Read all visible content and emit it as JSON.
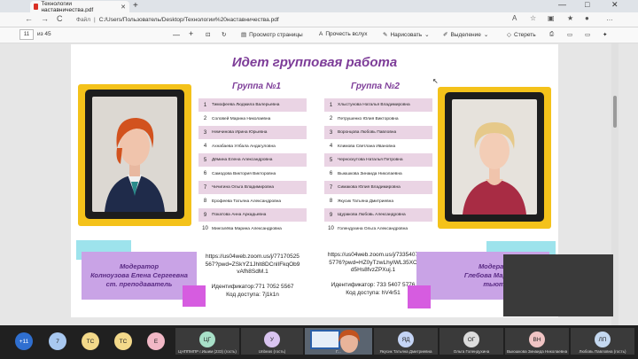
{
  "browser": {
    "tab_title": "Технологии наставничества.pdf",
    "new_tab": "+",
    "win_min": "—",
    "win_max": "□",
    "win_close": "✕",
    "back": "←",
    "forward": "→",
    "refresh": "C",
    "address_label": "Файл",
    "address_sep": "|",
    "address": "C:/Users/Пользователь/Desktop/Технологии%20наставничества.pdf"
  },
  "pdf_toolbar": {
    "page_current": "11",
    "page_of": "из 45",
    "zoom_out": "—",
    "zoom_in": "+",
    "view": "Просмотр страницы",
    "read_aloud": "Прочесть вслух",
    "draw": "Нарисовать",
    "highlight": "Выделение",
    "erase": "Стереть"
  },
  "slide": {
    "title": "Идет групповая работа",
    "group1": {
      "title": "Группа №1",
      "members": [
        "Тимофеева Людмила Валерьевна",
        "Соловей Марина Николаевна",
        "Немчинова Ирина Юрьевна",
        "Ахнабаева Улбала Андагуловна",
        "Дёмина Елена Александровна",
        "Самодова Виктория Викторовна",
        "Чичигина Ольга Владимировна",
        "Ерофеева Татьяна Александровна",
        "Покатова Анна Аркадьевна",
        "Мингалёва Марина Александровна"
      ],
      "link": "https://us04web.zoom.us/j/77170525567?pwd=ZSkYZ1Jhlt8DCnlIFkqOb9vAfh8SdM.1",
      "link_lines": [
        "https://us04web.zoom.us/j/77170525",
        "567?pwd=ZSkYZ1Jhlt8DCnlIFkqOb9",
        "vAfh8SdM.1"
      ],
      "meeting_id": "Идентификатор:771 7052 5567",
      "passcode": "Код доступа: 7j1k1n"
    },
    "group2": {
      "title": "Группа №2",
      "members": [
        "Хлыстунова Наталья Владимировна",
        "Петрушенко Юлия Викторовна",
        "Воронцова Любовь Павловна",
        "Климова Светлана Ивановна",
        "Черноскутова Наталья Петровна",
        "Выюшкова Зинаида Николаевна",
        "Симакова Юлия Владимировна",
        "Якусик Татьяна Дмитриевна",
        "Щуракова  Любовь Александровна",
        "Голендухина Ольга Александровна"
      ],
      "link_lines": [
        "https://us04web.zoom.us/j/7335407",
        "5776?pwd=HZ0yTzwLhyIWL35XC",
        "d5Hs8fvzZPXuj.1"
      ],
      "meeting_id": "Идентификатор: 733 5407 5776",
      "passcode": "Код доступа: hV4r51"
    },
    "moderator1": [
      "Модератор",
      "Колноузова Елена Сергеевна",
      "ст. преподаватель"
    ],
    "moderator2": [
      "Модератор",
      "Глебова Маргарита",
      "тьютор"
    ]
  },
  "participants": {
    "more": "+11",
    "avatars": [
      {
        "initials": "7",
        "color": "#a8c8f0"
      },
      {
        "initials": "ТС",
        "color": "#f3d98a"
      },
      {
        "initials": "ТС",
        "color": "#f3d98a"
      },
      {
        "initials": "Е",
        "color": "#f2b8c6"
      }
    ],
    "tiles": [
      {
        "initials": "ЦГ",
        "color": "#a8e0c8",
        "caption": "ЦНППМПР г.Ишим (233) (гость)"
      },
      {
        "initials": "У",
        "color": "#d9c4f0",
        "caption": "Unbeas (гость)"
      },
      {
        "initials": "ЯД",
        "color": "#c4d4f5",
        "caption": "Якусик Татьяна Дмитриевна"
      },
      {
        "initials": "ОГ",
        "color": "#dcdcdc",
        "caption": "Ольга Голендухина"
      },
      {
        "initials": "ВН",
        "color": "#f0c4c4",
        "caption": "Выюшкова Зинаида Николаевна (г..."
      },
      {
        "initials": "ЛП",
        "color": "#c4d8f0",
        "caption": "Любовь Павловна (гость)"
      }
    ],
    "video_caption": "Г..."
  }
}
